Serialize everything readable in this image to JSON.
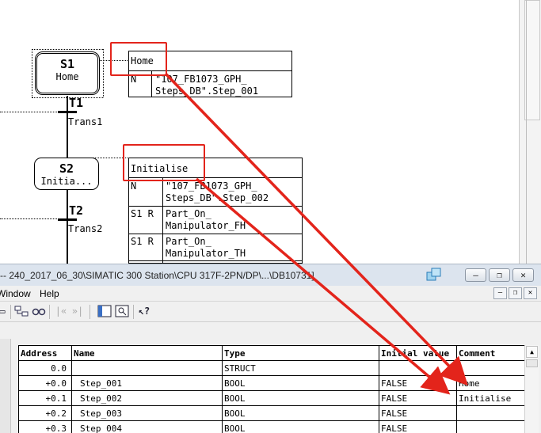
{
  "graph": {
    "steps": [
      {
        "id": "S1",
        "desc": "Home"
      },
      {
        "id": "S2",
        "desc": "Initia..."
      }
    ],
    "transitions": [
      {
        "id": "T1",
        "label": "Trans1"
      },
      {
        "id": "T2",
        "label": "Trans2"
      }
    ],
    "action_tables": [
      {
        "header": "Home",
        "rows": [
          {
            "qualifier": "N",
            "action_line1": "\"107_FB1073_GPH_",
            "action_line2": "Steps_DB\".Step_001"
          }
        ]
      },
      {
        "header": "Initialise",
        "rows": [
          {
            "qualifier": "N",
            "action_line1": "\"107_FB1073_GPH_",
            "action_line2": "Steps_DB\".Step_002"
          },
          {
            "qualifier": "S1 R",
            "action_line1": "Part_On_",
            "action_line2": "Manipulator_FH"
          },
          {
            "qualifier": "S1 R",
            "action_line1": "Part_On_",
            "action_line2": "Manipulator_TH"
          }
        ]
      }
    ],
    "accent_color": "#e3241b"
  },
  "db_window": {
    "title": "-- 240_2017_06_30\\SIMATIC 300 Station\\CPU 317F-2PN/DP\\...\\DB10731]",
    "window_buttons": {
      "minimize": "‒",
      "restore": "❐",
      "close": "✕"
    },
    "menu": [
      {
        "label": "Window"
      },
      {
        "label": "Help"
      }
    ],
    "mdi_buttons": {
      "minimize": "‒",
      "restore": "❐",
      "close": "✕"
    },
    "toolbar_icons": [
      "network-view-icon",
      "glasses-icon",
      "back-icon",
      "forward-icon",
      "layout-icon",
      "preview-icon",
      "help-pointer-icon"
    ],
    "table": {
      "columns": [
        "Address",
        "Name",
        "Type",
        "Initial value",
        "Comment"
      ],
      "rows": [
        {
          "address": "0.0",
          "name": "",
          "type": "STRUCT",
          "initial": "",
          "comment": ""
        },
        {
          "address": "+0.0",
          "name": "Step_001",
          "type": "BOOL",
          "initial": "FALSE",
          "comment": "Home"
        },
        {
          "address": "+0.1",
          "name": "Step_002",
          "type": "BOOL",
          "initial": "FALSE",
          "comment": "Initialise"
        },
        {
          "address": "+0.2",
          "name": "Step_003",
          "type": "BOOL",
          "initial": "FALSE",
          "comment": ""
        },
        {
          "address": "+0.3",
          "name": "Step_004",
          "type": "BOOL",
          "initial": "FALSE",
          "comment": ""
        }
      ]
    }
  }
}
